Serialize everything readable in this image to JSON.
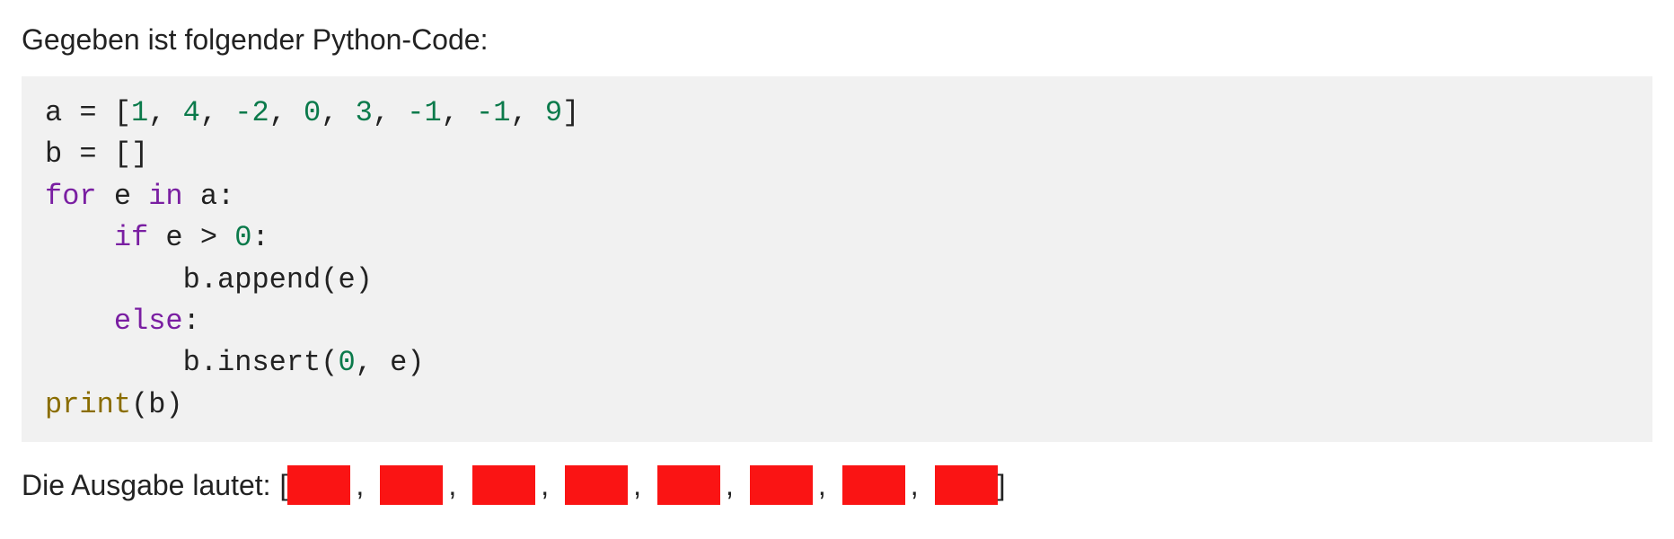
{
  "prompt": "Gegeben ist folgender Python-Code:",
  "code": {
    "l1_pre": "a = [",
    "l1_nums": [
      "1",
      "4",
      "-2",
      "0",
      "3",
      "-1",
      "-1",
      "9"
    ],
    "l1_post": "]",
    "l2": "b = []",
    "l3_kw_for": "for",
    "l3_mid": " e ",
    "l3_kw_in": "in",
    "l3_post": " a:",
    "l4_indent": "    ",
    "l4_kw_if": "if",
    "l4_mid": " e > ",
    "l4_zero": "0",
    "l4_post": ":",
    "l5": "        b.append(e)",
    "l6_indent": "    ",
    "l6_kw_else": "else",
    "l6_post": ":",
    "l7_pre": "        b.insert(",
    "l7_zero": "0",
    "l7_post": ", e)",
    "l8_print": "print",
    "l8_post": "(b)"
  },
  "answer_label": "Die Ausgabe lautet:",
  "bracket_open": "[",
  "bracket_close": "]",
  "comma": ",",
  "slot_count": 8
}
